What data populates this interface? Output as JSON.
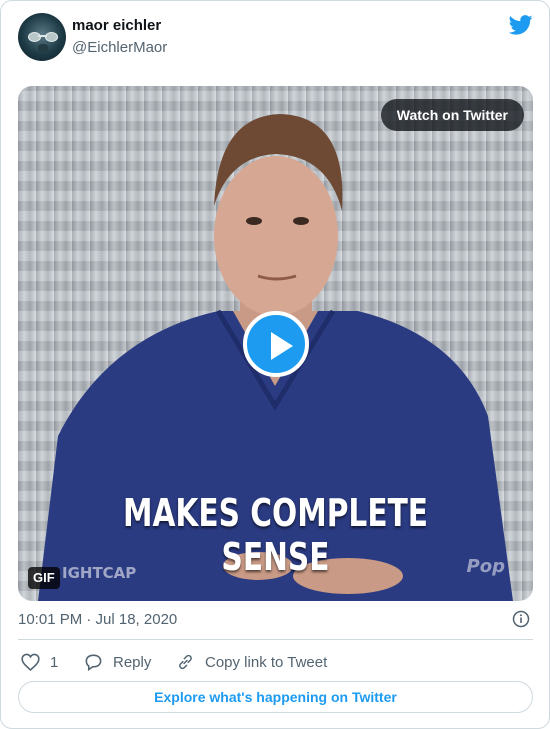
{
  "tweet": {
    "author_name": "maor eichler",
    "author_handle": "@EichlerMaor",
    "timestamp": "10:01 PM · Jul 18, 2020",
    "media": {
      "watch_label": "Watch on Twitter",
      "gif_badge": "GIF",
      "caption": "MAKES COMPLETE SENSE",
      "watermark_left": "IGHTCAP",
      "watermark_right": "Pop"
    },
    "actions": {
      "like_count": "1",
      "reply_label": "Reply",
      "copy_label": "Copy link to Tweet"
    },
    "explore_label": "Explore what's happening on Twitter"
  },
  "icons": {
    "brand": "twitter-bird-icon",
    "play": "play-icon",
    "info": "info-icon",
    "like": "heart-icon",
    "reply": "reply-bubble-icon",
    "copy": "link-icon"
  },
  "colors": {
    "brand": "#1d9bf0",
    "text_primary": "#0f1419",
    "text_secondary": "#536471",
    "border": "#cfd9de"
  }
}
